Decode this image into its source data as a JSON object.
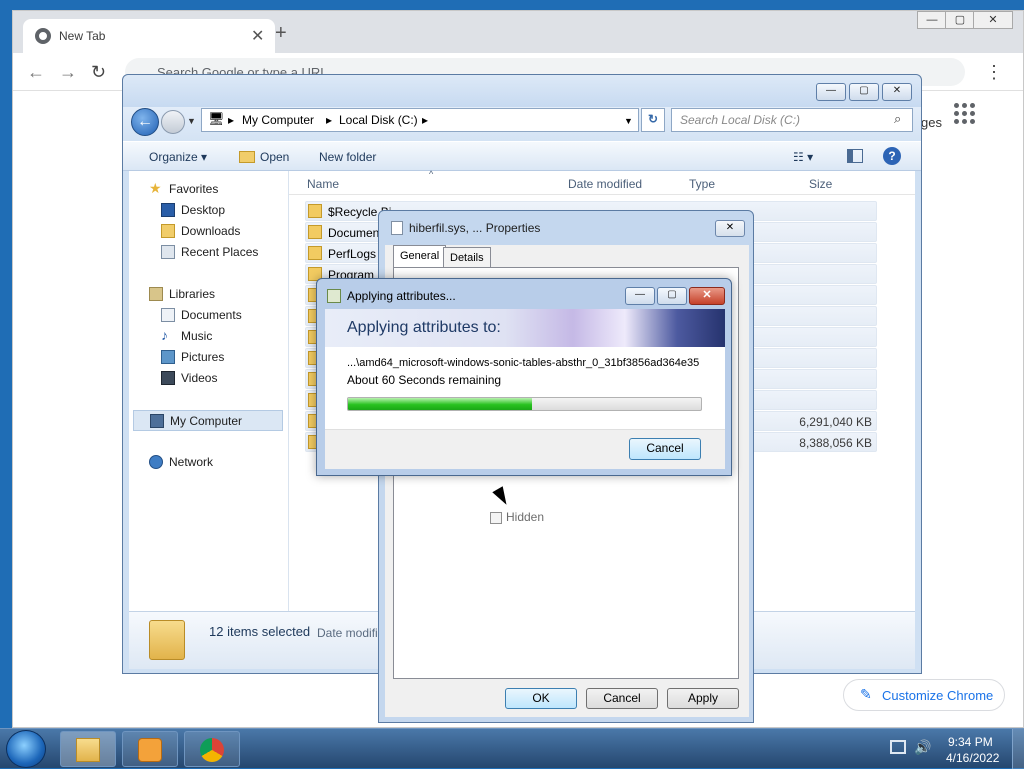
{
  "chrome": {
    "tab_title": "New Tab",
    "tab_close": "✕",
    "new_tab": "+",
    "omnibox_placeholder": "Search Google or type a URL",
    "customize_label": "Customize Chrome",
    "partial_right_text": "ges",
    "window_controls": [
      "—",
      "▢",
      "✕"
    ],
    "back_glyph": "←",
    "forward_glyph": "→",
    "reload_glyph": "↻",
    "menu_glyph": "⋮"
  },
  "explorer": {
    "breadcrumb": [
      "My Computer",
      "Local Disk (C:)"
    ],
    "search_placeholder": "Search Local Disk (C:)",
    "commands": {
      "organize": "Organize ▾",
      "open": "Open",
      "new_folder": "New folder"
    },
    "nav": {
      "favorites_header": "Favorites",
      "favorites": [
        "Desktop",
        "Downloads",
        "Recent Places"
      ],
      "libraries_header": "Libraries",
      "libraries": [
        "Documents",
        "Music",
        "Pictures",
        "Videos"
      ],
      "computer": "My Computer",
      "network": "Network"
    },
    "columns": [
      "Name",
      "Date modified",
      "Type",
      "Size"
    ],
    "files": [
      {
        "name": "$Recycle.Bi",
        "size": ""
      },
      {
        "name": "Documen",
        "size": ""
      },
      {
        "name": "PerfLogs",
        "size": ""
      },
      {
        "name": "Program",
        "size": ""
      },
      {
        "name": "",
        "size": ""
      },
      {
        "name": "",
        "size": ""
      },
      {
        "name": "",
        "size": ""
      },
      {
        "name": "",
        "size": ""
      },
      {
        "name": "",
        "size": ""
      },
      {
        "name": "",
        "size": ""
      },
      {
        "name": "",
        "size": "6,291,040 KB"
      },
      {
        "name": "",
        "size": "8,388,056 KB"
      }
    ],
    "details": {
      "count": "12 items selected",
      "date_label": "Date modifi"
    }
  },
  "properties": {
    "title": "hiberfil.sys, ... Properties",
    "tabs": [
      "General",
      "Details"
    ],
    "hidden_label": "Hidden",
    "buttons": {
      "ok": "OK",
      "cancel": "Cancel",
      "apply": "Apply"
    }
  },
  "applying": {
    "title": "Applying attributes...",
    "heading": "Applying attributes to:",
    "path": "...\\amd64_microsoft-windows-sonic-tables-absthr_0_31bf3856ad364e35",
    "remaining": "About 60 Seconds remaining",
    "progress": 0.52,
    "cancel": "Cancel"
  },
  "taskbar": {
    "time": "9:34 PM",
    "date": "4/16/2022"
  },
  "colors": {
    "progress_green": "#29c220",
    "accent_blue": "#1a73e8"
  }
}
